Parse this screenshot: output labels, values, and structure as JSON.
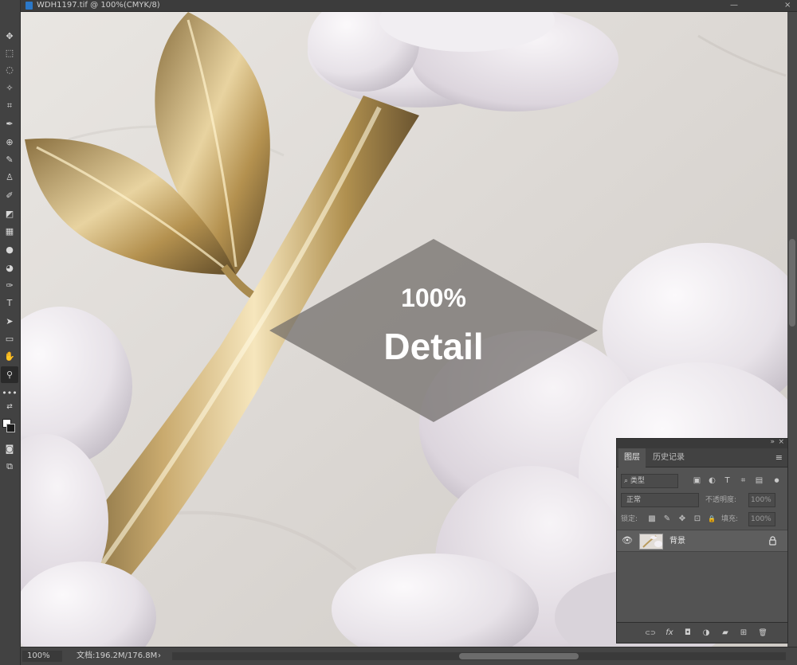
{
  "document": {
    "tab_title": "WDH1197.tif @ 100%(CMYK/8)",
    "minimize_glyph": "—",
    "close_glyph": "×"
  },
  "toolbar": {
    "tools": [
      {
        "icon": "move-icon",
        "glyph": "✥"
      },
      {
        "icon": "marquee-icon",
        "glyph": "⬚"
      },
      {
        "icon": "lasso-icon",
        "glyph": "◌"
      },
      {
        "icon": "magic-wand-icon",
        "glyph": "✧"
      },
      {
        "icon": "crop-icon",
        "glyph": "⌗"
      },
      {
        "icon": "eyedropper-icon",
        "glyph": "✒"
      },
      {
        "icon": "healing-brush-icon",
        "glyph": "⊕"
      },
      {
        "icon": "brush-icon",
        "glyph": "✎"
      },
      {
        "icon": "clone-stamp-icon",
        "glyph": "♙"
      },
      {
        "icon": "history-brush-icon",
        "glyph": "✐"
      },
      {
        "icon": "eraser-icon",
        "glyph": "◩"
      },
      {
        "icon": "gradient-icon",
        "glyph": "▦"
      },
      {
        "icon": "blur-icon",
        "glyph": "●"
      },
      {
        "icon": "dodge-icon",
        "glyph": "◕"
      },
      {
        "icon": "pen-icon",
        "glyph": "✑"
      },
      {
        "icon": "type-icon",
        "glyph": "T"
      },
      {
        "icon": "path-selection-icon",
        "glyph": "➤"
      },
      {
        "icon": "rectangle-icon",
        "glyph": "▭"
      },
      {
        "icon": "hand-icon",
        "glyph": "✋"
      },
      {
        "icon": "zoom-icon",
        "glyph": "⚲"
      },
      {
        "icon": "more-tools-icon",
        "glyph": "•••"
      }
    ],
    "extra": [
      {
        "icon": "swap-colors-icon",
        "glyph": "⇄"
      },
      {
        "icon": "quick-mask-icon",
        "glyph": "◙"
      },
      {
        "icon": "screen-mode-icon",
        "glyph": "⧉"
      }
    ]
  },
  "canvas": {
    "badge": {
      "percent": "100%",
      "word": "Detail"
    }
  },
  "status_bar": {
    "zoom": "100%",
    "doc_size": "文档:196.2M/176.8M",
    "arrow": "›"
  },
  "layers_panel": {
    "collapse_glyph": "»",
    "close_glyph": "×",
    "tabs": [
      {
        "label": "图层"
      },
      {
        "label": "历史记录"
      }
    ],
    "menu_glyph": "≡",
    "filter_kind": "⌕ 类型",
    "filter_buttons": [
      {
        "icon": "pixel-filter-icon",
        "glyph": "▣"
      },
      {
        "icon": "adjustment-filter-icon",
        "glyph": "◐"
      },
      {
        "icon": "type-filter-icon",
        "glyph": "T"
      },
      {
        "icon": "shape-filter-icon",
        "glyph": "⌗"
      },
      {
        "icon": "smart-object-filter-icon",
        "glyph": "▤"
      },
      {
        "icon": "filter-toggle-icon",
        "glyph": "●"
      }
    ],
    "blend_mode": "正常",
    "opacity_label": "不透明度:",
    "opacity_value": "100%",
    "lock_label": "锁定:",
    "lock_buttons": [
      {
        "icon": "lock-transparent-icon",
        "glyph": "▩"
      },
      {
        "icon": "lock-image-icon",
        "glyph": "✎"
      },
      {
        "icon": "lock-position-icon",
        "glyph": "✥"
      },
      {
        "icon": "lock-artboard-icon",
        "glyph": "⊡"
      },
      {
        "icon": "lock-all-icon",
        "glyph": "🔒"
      }
    ],
    "fill_label": "填充:",
    "fill_value": "100%",
    "layer": {
      "eye_glyph": "👁",
      "name": "背景"
    },
    "bottom_buttons": [
      {
        "icon": "link-layers-icon",
        "glyph": "⊂⊃"
      },
      {
        "icon": "fx-icon",
        "glyph": "fx"
      },
      {
        "icon": "add-mask-icon",
        "glyph": "◘"
      },
      {
        "icon": "adjustment-layer-icon",
        "glyph": "◑"
      },
      {
        "icon": "new-group-icon",
        "glyph": "▰"
      },
      {
        "icon": "new-layer-icon",
        "glyph": "⊞"
      },
      {
        "icon": "delete-layer-icon",
        "glyph": "🗑"
      }
    ]
  }
}
